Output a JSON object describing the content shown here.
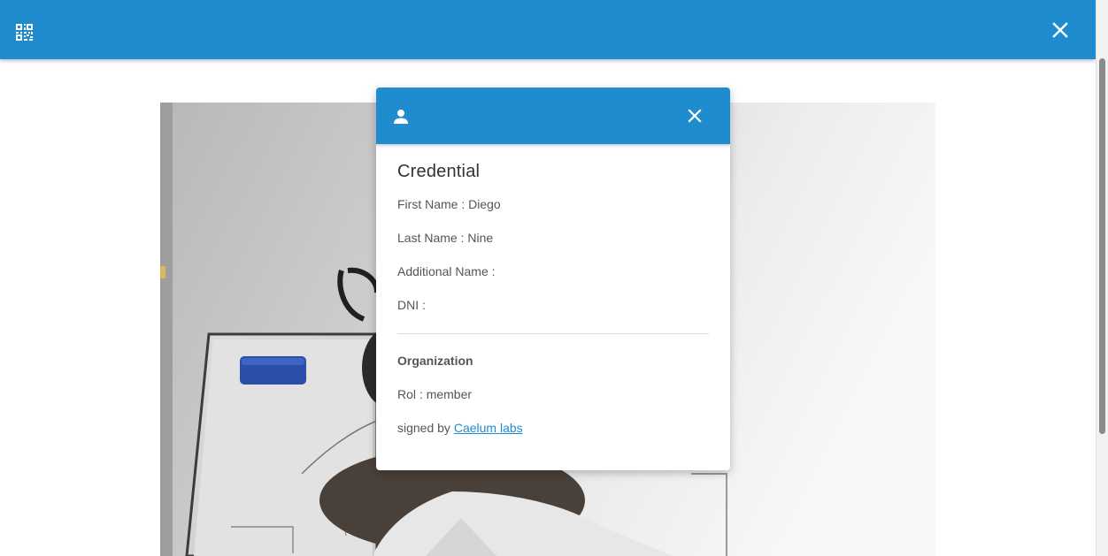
{
  "appbar": {
    "qr_icon": "qr-code-icon",
    "close_icon": "close-icon",
    "color": "#1f8ccf"
  },
  "camera": {
    "description_icon": "camera-feed"
  },
  "credential_modal": {
    "header_icon": "person-icon",
    "close_icon": "close-icon",
    "title": "Credential",
    "fields": {
      "first_name_label": "First Name :",
      "first_name_value": "Diego",
      "last_name_label": "Last Name :",
      "last_name_value": "Nine",
      "additional_name_label": "Additional Name :",
      "additional_name_value": "",
      "dni_label": "DNI :",
      "dni_value": ""
    },
    "organization": {
      "heading": "Organization",
      "rol_label": "Rol :",
      "rol_value": "member",
      "signed_by_label": "signed by",
      "signer": "Caelum labs"
    }
  },
  "colors": {
    "accent": "#1f8ccf",
    "link": "#1f8ccf",
    "text": "#555555"
  }
}
